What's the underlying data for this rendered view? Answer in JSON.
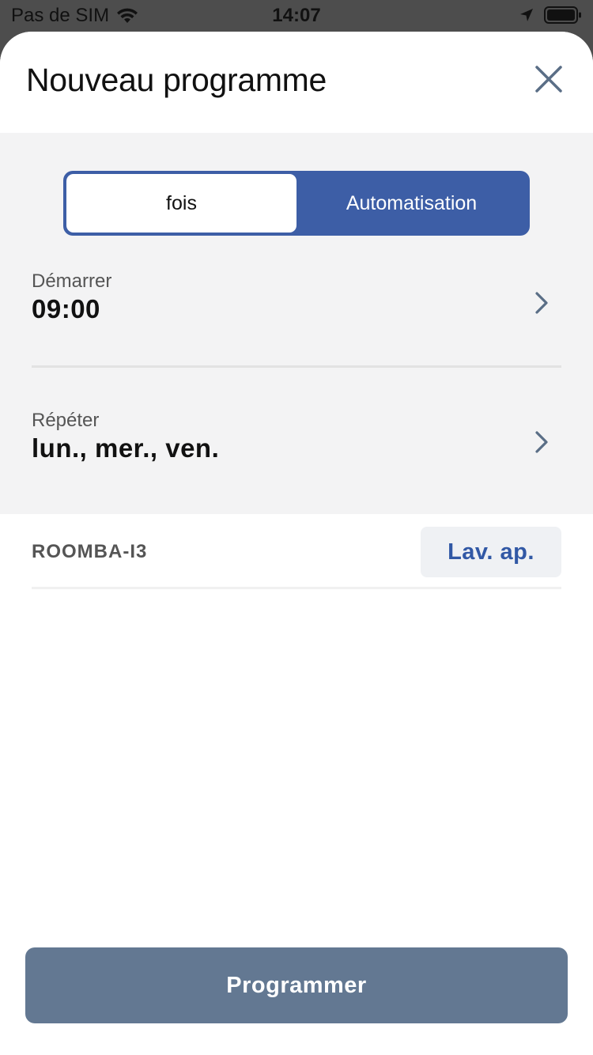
{
  "status_bar": {
    "carrier": "Pas de SIM",
    "time": "14:07",
    "wifi_icon": "wifi-icon",
    "location_icon": "location-arrow-icon",
    "battery_icon": "battery-icon"
  },
  "header": {
    "title": "Nouveau programme",
    "close_icon": "close-icon"
  },
  "segmented_control": {
    "options": [
      "fois",
      "Automatisation"
    ],
    "selected": "fois",
    "active_color": "#3d5ea6"
  },
  "start": {
    "label": "Démarrer",
    "value": "09:00"
  },
  "repeat": {
    "label": "Répéter",
    "value": "lun., mer., ven."
  },
  "robot": {
    "name": "ROOMBA-I3",
    "action_label": "Lav. ap."
  },
  "footer": {
    "primary_label": "Programmer",
    "primary_color": "#637892"
  }
}
